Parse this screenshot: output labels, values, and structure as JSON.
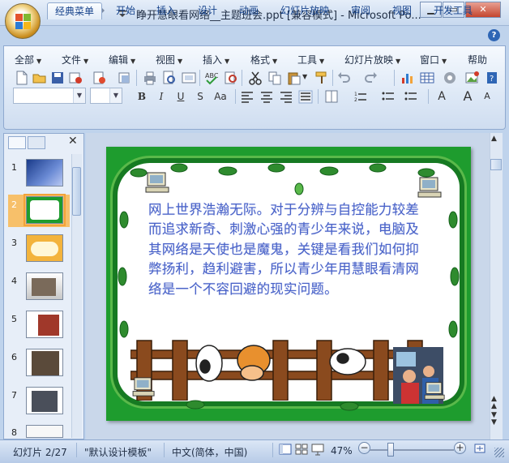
{
  "window": {
    "title": "睁开慧眼看网络__主题班会.ppt [兼容模式] - Microsoft Po...",
    "minimize_label": "▁",
    "maximize_label": "▭",
    "close_label": "✕"
  },
  "ribbon_tabs": [
    "经典菜单",
    "开始",
    "插入",
    "设计",
    "动画",
    "幻灯片放映",
    "审阅",
    "视图",
    "开发工具"
  ],
  "help_label": "?",
  "classic_menus": [
    "全部",
    "文件",
    "编辑",
    "视图",
    "插入",
    "格式",
    "工具",
    "幻灯片放映",
    "窗口",
    "帮助"
  ],
  "format_buttons": [
    "B",
    "I",
    "U",
    "S",
    "Aa"
  ],
  "font_size_buttons": [
    "A",
    "A",
    "A"
  ],
  "slides": {
    "numbers": [
      "1",
      "2",
      "3",
      "4",
      "5",
      "6",
      "7",
      "8"
    ],
    "selected_index": 2
  },
  "slide": {
    "body_text": "网上世界浩瀚无际。对于分辨与自控能力较差而追求新奇、刺激心强的青少年来说，电脑及其网络是天使也是魔鬼，关键是看我们如何抑弊扬利，趋利避害，所以青少年用慧眼看清网络是一个不容回避的现实问题。"
  },
  "status": {
    "slide_counter": "幻灯片 2/27",
    "template": "\"默认设计模板\"",
    "language": "中文(简体，中国)",
    "zoom": "47%",
    "zoom_minus": "−",
    "zoom_plus": "+"
  },
  "colors": {
    "accent_blue": "#15428b",
    "slide_green": "#1e9c2e",
    "slide_text": "#4a63c8",
    "selected_outline": "#f2a33a"
  }
}
